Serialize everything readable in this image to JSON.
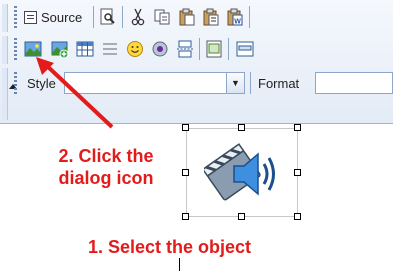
{
  "toolbar": {
    "source_label": "Source",
    "row1_icons": [
      "preview-icon",
      "cut-icon",
      "copy-icon",
      "paste-icon",
      "paste-text-icon",
      "paste-word-icon"
    ],
    "row2_icons": [
      "image-icon",
      "insert-image-icon",
      "table-icon",
      "horizontal-rule-icon",
      "smiley-icon",
      "special-char-icon",
      "page-break-icon",
      "iframe-icon",
      "form-icon"
    ],
    "style_label": "Style",
    "style_value": "",
    "format_label": "Format",
    "format_value": ""
  },
  "annotations": {
    "step2_line1": "2. Click the",
    "step2_line2": "dialog icon",
    "step1": "1. Select the object"
  },
  "selected_object": {
    "icon": "audio-video-icon"
  },
  "colors": {
    "annotation": "#e31b1b",
    "toolbar_bg": "#e3ebf6",
    "toolbar_border": "#9db5d6"
  }
}
